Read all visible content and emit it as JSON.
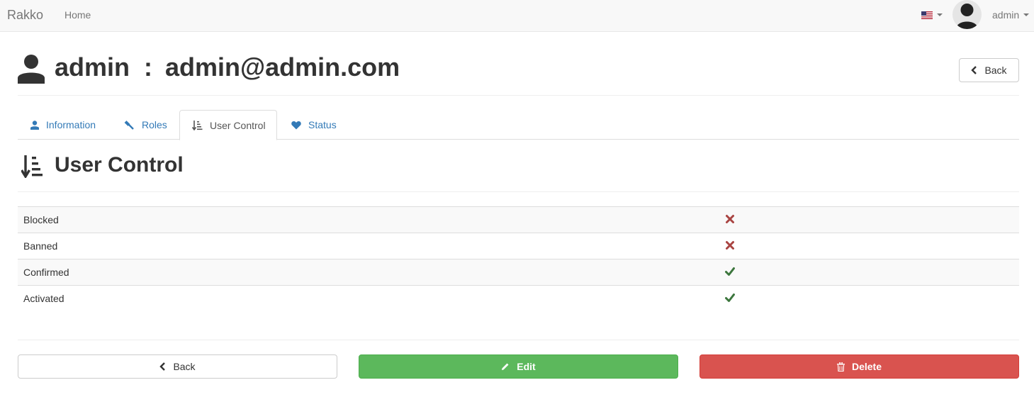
{
  "navbar": {
    "brand": "Rakko",
    "home_label": "Home",
    "language_icon": "us-flag-icon",
    "user_label": "admin"
  },
  "header": {
    "username": "admin",
    "separator": ":",
    "email": "admin@admin.com",
    "back_label": "Back"
  },
  "tabs": [
    {
      "label": "Information",
      "icon": "user-icon"
    },
    {
      "label": "Roles",
      "icon": "gavel-icon"
    },
    {
      "label": "User Control",
      "icon": "sort-amount-icon"
    },
    {
      "label": "Status",
      "icon": "heart-icon"
    }
  ],
  "active_tab": "User Control",
  "section": {
    "title": "User Control",
    "icon": "sort-amount-icon"
  },
  "controls": [
    {
      "label": "Blocked",
      "value": false,
      "icon": "cross-icon"
    },
    {
      "label": "Banned",
      "value": false,
      "icon": "cross-icon"
    },
    {
      "label": "Confirmed",
      "value": true,
      "icon": "check-icon"
    },
    {
      "label": "Activated",
      "value": true,
      "icon": "check-icon"
    }
  ],
  "actions": {
    "back_label": "Back",
    "edit_label": "Edit",
    "delete_label": "Delete"
  },
  "colors": {
    "link": "#337ab7",
    "success": "#5cb85c",
    "danger": "#d9534f",
    "cross": "#a94442",
    "check": "#3c763d"
  }
}
